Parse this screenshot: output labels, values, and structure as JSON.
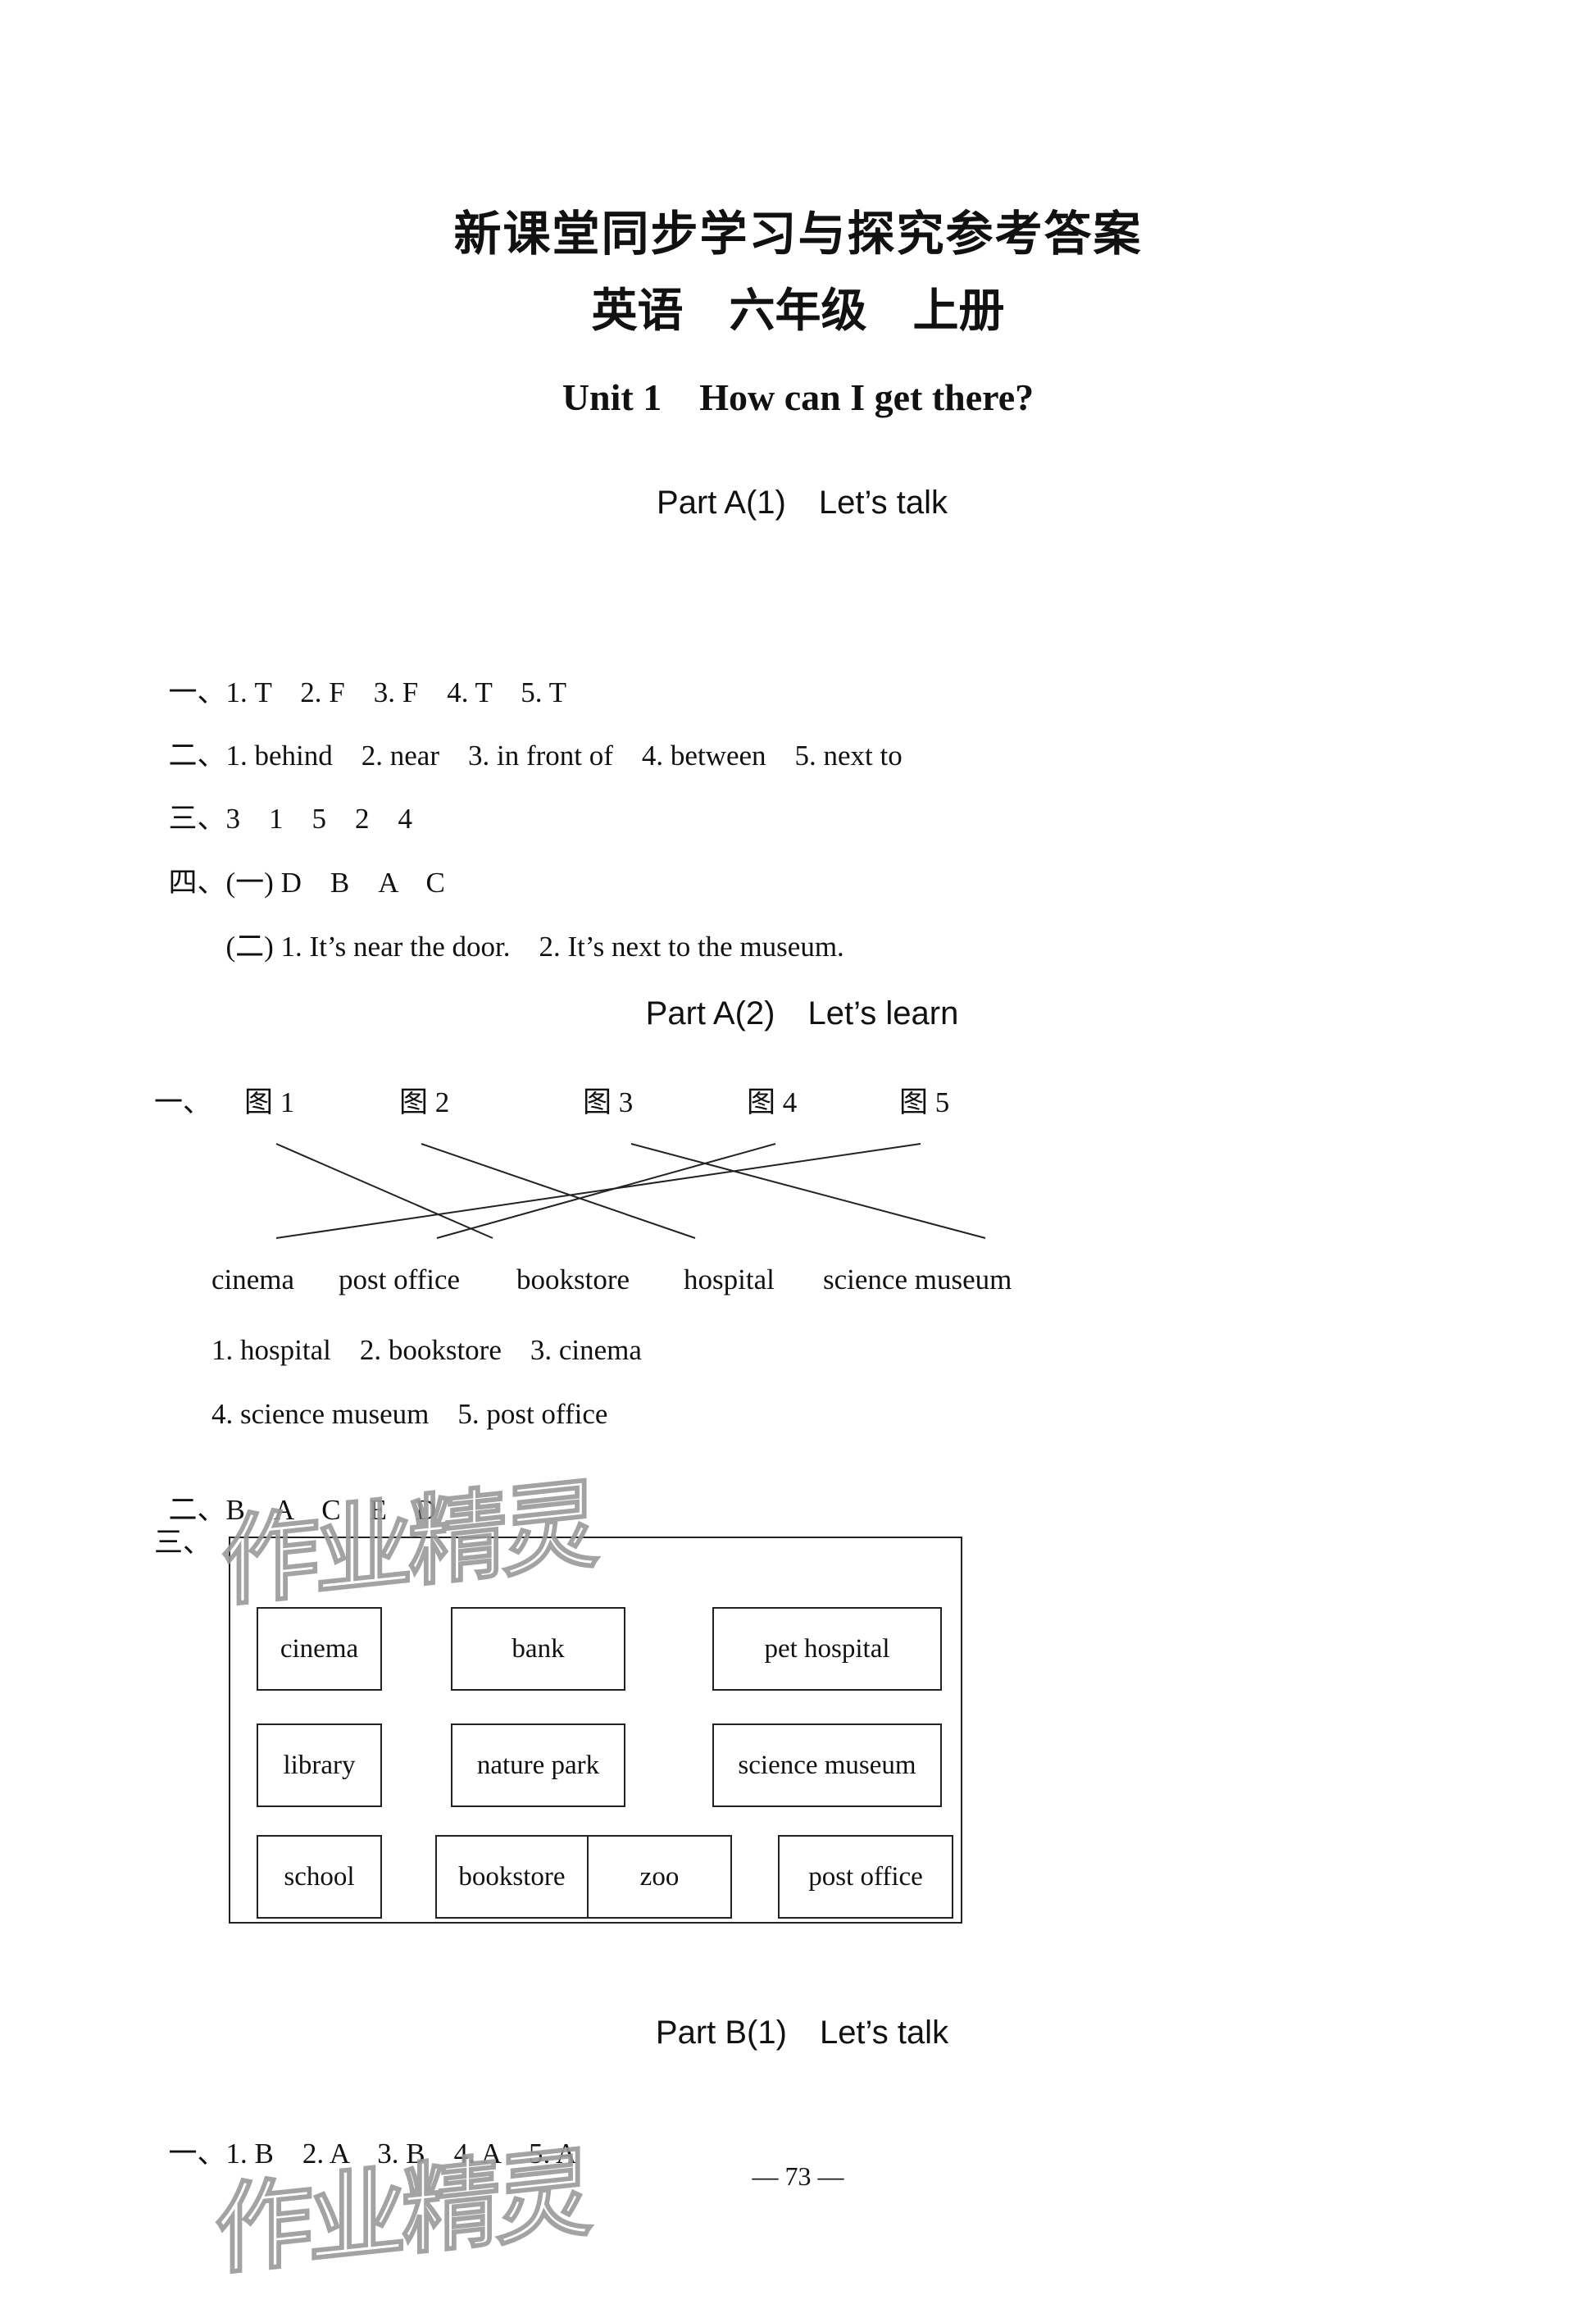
{
  "header": {
    "title": "新课堂同步学习与探究参考答案",
    "subtitle": "英语　六年级　上册",
    "unit": "Unit 1　How can I get there?"
  },
  "sections": [
    {
      "heading": "Part A(1)　Let’s talk",
      "answers": [
        {
          "label": "一、",
          "text": "1. T　2. F　3. F　4. T　5. T"
        },
        {
          "label": "二、",
          "text": "1. behind　2. near　3. in front of　4. between　5. next to"
        },
        {
          "label": "三、",
          "text": "3　1　5　2　4"
        },
        {
          "label": "四、",
          "text": "(一) D　B　A　C"
        },
        {
          "label": "",
          "text": "(二) 1. It’s near the door.　2. It’s next to the museum."
        }
      ]
    },
    {
      "heading": "Part A(2)　Let’s learn",
      "matching": {
        "label": "一、",
        "figures": [
          "图 1",
          "图 2",
          "图 3",
          "图 4",
          "图 5"
        ],
        "words": [
          "cinema",
          "post office",
          "bookstore",
          "hospital",
          "science museum"
        ],
        "connections": [
          {
            "figure": "图 1",
            "word": "bookstore"
          },
          {
            "figure": "图 2",
            "word": "hospital"
          },
          {
            "figure": "图 3",
            "word": "science museum"
          },
          {
            "figure": "图 4",
            "word": "post office"
          },
          {
            "figure": "图 5",
            "word": "cinema"
          }
        ],
        "sub_answers": [
          "1. hospital　2. bookstore　3. cinema",
          "4. science museum　5. post office"
        ]
      },
      "answers": [
        {
          "label": "二、",
          "text": "B　A　C　E　D"
        }
      ],
      "map": {
        "label": "三、",
        "rows": [
          [
            "cinema",
            "bank",
            "pet hospital"
          ],
          [
            "library",
            "nature park",
            "science museum"
          ],
          [
            "school",
            "bookstore",
            "zoo",
            "post office"
          ]
        ]
      }
    },
    {
      "heading": "Part B(1)　Let’s talk",
      "answers": [
        {
          "label": "一、",
          "text": "1. B　2. A　3. B　4. A　5. A"
        }
      ]
    }
  ],
  "page_number": "— 73 —",
  "watermark": "作业精灵"
}
